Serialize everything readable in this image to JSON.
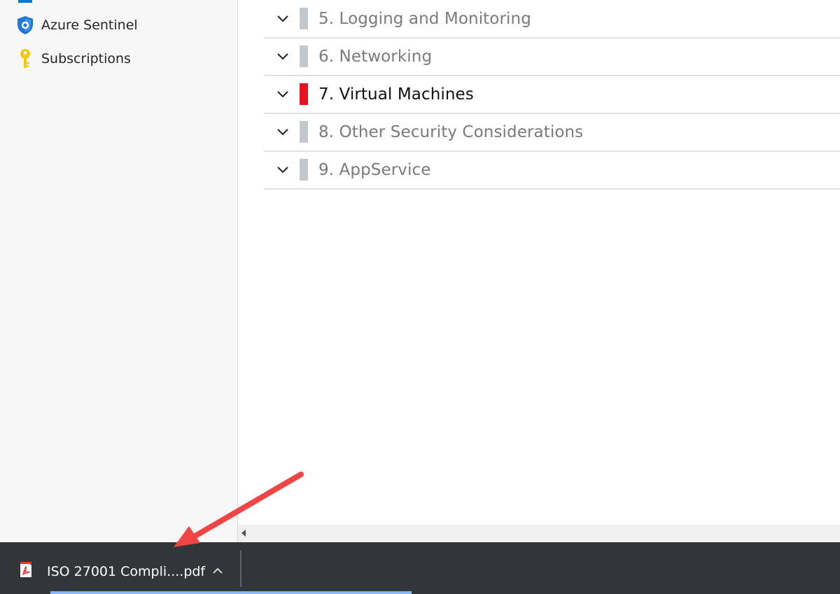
{
  "sidebar": {
    "items": [
      {
        "label": "Azure Sentinel",
        "icon": "azure-sentinel-shield-icon"
      },
      {
        "label": "Subscriptions",
        "icon": "key-icon"
      }
    ]
  },
  "sections": [
    {
      "label": "5. Logging and Monitoring",
      "status_color": "#c3c6ca",
      "active": false
    },
    {
      "label": "6. Networking",
      "status_color": "#c3c6ca",
      "active": false
    },
    {
      "label": "7. Virtual Machines",
      "status_color": "#e81123",
      "active": true
    },
    {
      "label": "8. Other Security Considerations",
      "status_color": "#c3c6ca",
      "active": false
    },
    {
      "label": "9. AppService",
      "status_color": "#c3c6ca",
      "active": false
    }
  ],
  "download_shelf": {
    "file_name": "ISO 27001 Compli....pdf",
    "file_icon": "pdf-file-icon",
    "menu_icon": "chevron-up-icon"
  },
  "colors": {
    "accent_red": "#e81123",
    "annotation_arrow": "#f04545",
    "shelf_bg": "#323639"
  }
}
